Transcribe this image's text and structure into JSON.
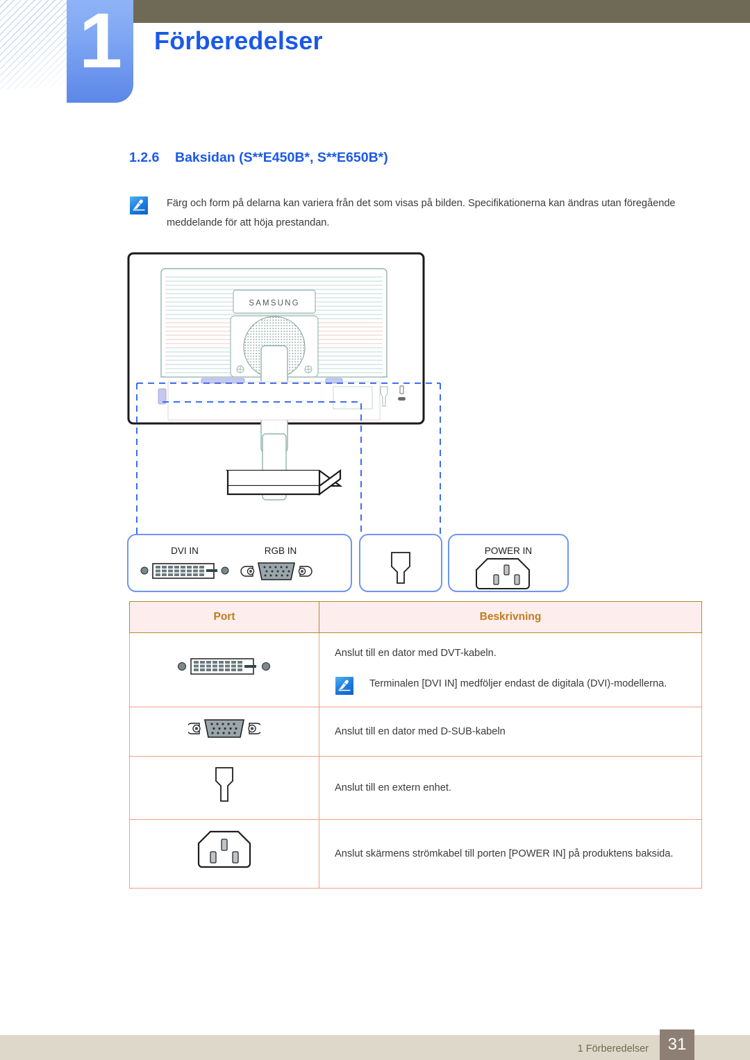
{
  "chapter": {
    "number": "1",
    "title": "Förberedelser"
  },
  "section": {
    "number": "1.2.6",
    "title": "Baksidan (S**E450B*, S**E650B*)"
  },
  "note": {
    "icon": "note-pen-icon",
    "text": "Färg och form på delarna kan variera från det som visas på bilden. Specifikationerna kan ändras utan föregående meddelande för att höja prestandan."
  },
  "illustration": {
    "device_brand": "SAMSUNG",
    "callouts": [
      {
        "id": "callout-video",
        "labels": [
          "DVI IN",
          "RGB IN"
        ]
      },
      {
        "id": "callout-external",
        "labels": []
      },
      {
        "id": "callout-power",
        "labels": [
          "POWER IN"
        ]
      }
    ]
  },
  "table": {
    "headers": [
      "Port",
      "Beskrivning"
    ],
    "rows": [
      {
        "port_icon": "dvi-port-icon",
        "description": "Anslut till en dator med DVT-kabeln.",
        "sub_note_icon": "note-pen-icon",
        "sub_note": "Terminalen [DVI IN] medföljer endast de digitala (DVI)-modellerna."
      },
      {
        "port_icon": "vga-dsub-port-icon",
        "description": "Anslut till en dator med D-SUB-kabeln"
      },
      {
        "port_icon": "external-device-port-icon",
        "description": "Anslut till en extern enhet."
      },
      {
        "port_icon": "power-in-port-icon",
        "description": "Anslut skärmens strömkabel till porten [POWER IN] på produktens baksida."
      }
    ]
  },
  "footer": {
    "label": "1 Förberedelser",
    "page": "31"
  },
  "colors": {
    "accent_blue": "#1a5ae8",
    "olive": "#6e6a55",
    "header_gold": "#c07c1c",
    "table_border": "#eda185",
    "footer_bar": "#ddd8c9",
    "page_badge": "#8e7f74",
    "callout_blue": "#3b6ef0"
  }
}
